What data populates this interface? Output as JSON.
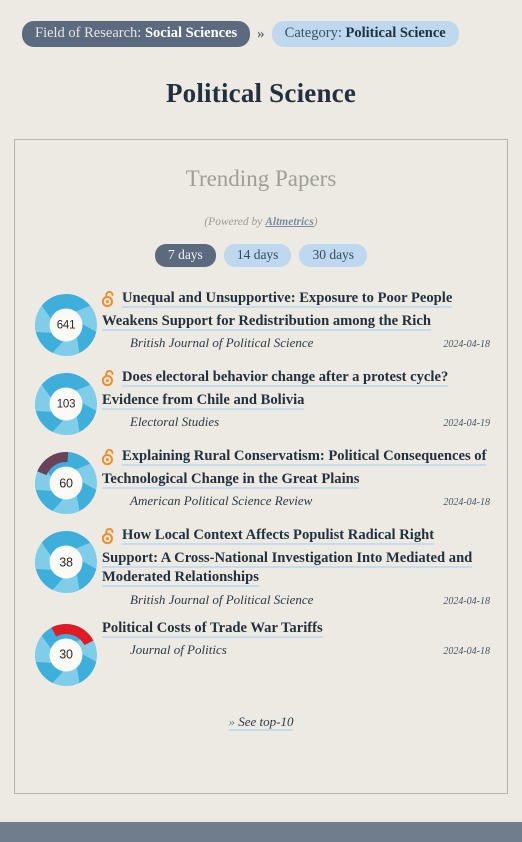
{
  "breadcrumb": {
    "field_label": "Field of Research:",
    "field_value": "Social Sciences",
    "separator": "»",
    "category_label": "Category:",
    "category_value": "Political Science"
  },
  "page_title": "Political Science",
  "card": {
    "title": "Trending Papers",
    "powered_prefix": "(Powered by ",
    "powered_link": "Altmetrics",
    "powered_suffix": ")",
    "day_filters": [
      {
        "label": "7 days",
        "active": true
      },
      {
        "label": "14 days",
        "active": false
      },
      {
        "label": "30 days",
        "active": false
      }
    ],
    "see_more_chevron": "»",
    "see_more_label": "See top-10"
  },
  "colors": {
    "page_bg": "#eceae3",
    "outer_bg": "#6f7d8c",
    "crumb_dark": "#5b6a7e",
    "crumb_light": "#bed8ef",
    "title_text": "#22303f",
    "card_title": "#9e9e97",
    "link_underline": "#c6dcee",
    "oa_orange": "#f28c28",
    "donut_blue": "#3eaedb",
    "donut_blue_light": "#7fcde8",
    "donut_red": "#e01b24",
    "donut_maroon": "#6b4358"
  },
  "papers": [
    {
      "score": "641",
      "open_access": true,
      "title": "Unequal and Unsupportive: Exposure to Poor People Weakens Support for Redistribution among the Rich",
      "journal": "British Journal of Political Science",
      "date": "2024-04-18",
      "accent": "none"
    },
    {
      "score": "103",
      "open_access": true,
      "title": "Does electoral behavior change after a protest cycle? Evidence from Chile and Bolivia",
      "journal": "Electoral Studies",
      "date": "2024-04-19",
      "accent": "none"
    },
    {
      "score": "60",
      "open_access": true,
      "title": "Explaining Rural Conservatism: Political Consequences of Technological Change in the Great Plains",
      "journal": "American Political Science Review",
      "date": "2024-04-18",
      "accent": "maroon"
    },
    {
      "score": "38",
      "open_access": true,
      "title": "How Local Context Affects Populist Radical Right Support: A Cross-National Investigation Into Mediated and Moderated Relationships",
      "journal": "British Journal of Political Science",
      "date": "2024-04-18",
      "accent": "none"
    },
    {
      "score": "30",
      "open_access": false,
      "title": "Political Costs of Trade War Tariffs",
      "journal": "Journal of Politics",
      "date": "2024-04-18",
      "accent": "red"
    }
  ]
}
